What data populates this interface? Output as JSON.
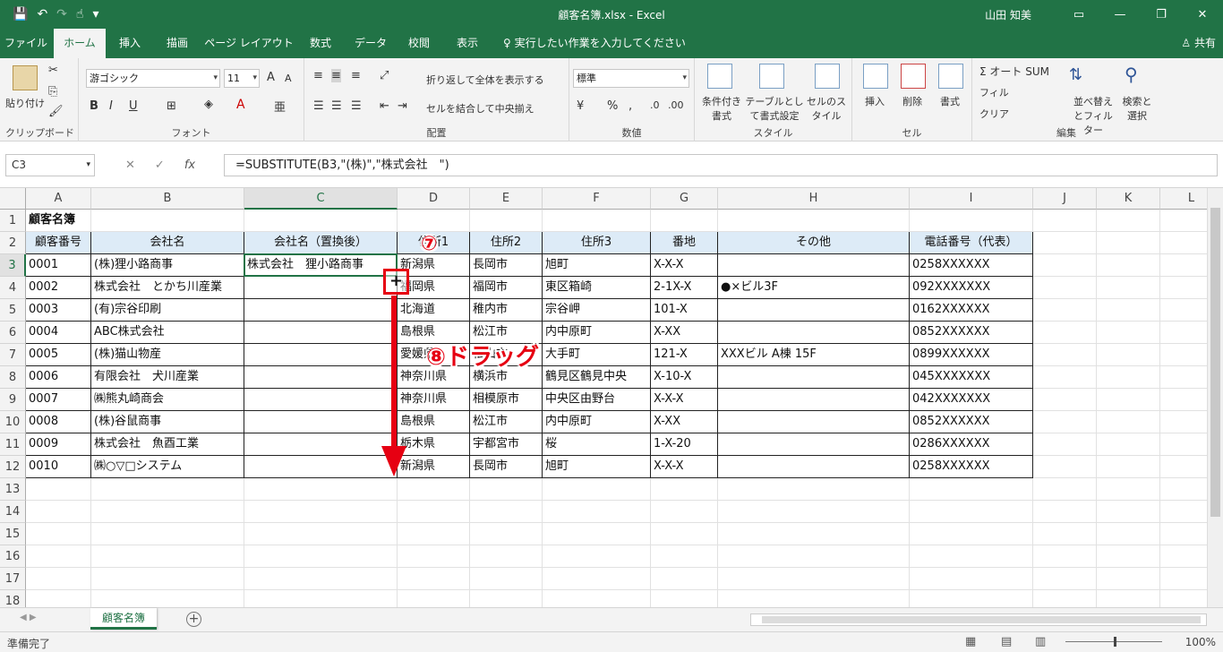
{
  "window": {
    "title": "顧客名簿.xlsx  -  Excel",
    "user": "山田 知美",
    "controls": [
      "▭",
      "—",
      "❐",
      "✕"
    ]
  },
  "qat": {
    "save": "💾",
    "undo": "↶",
    "redo": "↷",
    "touch": "☝",
    "more": "▾"
  },
  "tabs": [
    "ファイル",
    "ホーム",
    "挿入",
    "描画",
    "ページ レイアウト",
    "数式",
    "データ",
    "校閲",
    "表示"
  ],
  "tellme": "♀ 実行したい作業を入力してください",
  "share": "♙ 共有",
  "ribbon": {
    "clipboard": {
      "paste": "貼り付け",
      "label": "クリップボード"
    },
    "font": {
      "name": "游ゴシック",
      "size": "11",
      "bold": "B",
      "italic": "I",
      "underline": "U",
      "grow": "A",
      "shrink": "A",
      "label": "フォント"
    },
    "alignment": {
      "wrap": "折り返して全体を表示する",
      "merge": "セルを結合して中央揃え",
      "label": "配置"
    },
    "number": {
      "format": "標準",
      "percent": "%",
      "comma": ",",
      "label": "数値"
    },
    "styles": {
      "conditional": "条件付き書式",
      "table": "テーブルとして書式設定",
      "cell": "セルのスタイル",
      "label": "スタイル"
    },
    "cells": {
      "insert": "挿入",
      "delete": "削除",
      "format": "書式",
      "label": "セル"
    },
    "editing": {
      "autosum": "Σ オート SUM",
      "fill": "フィル",
      "clear": "クリア",
      "sort": "並べ替えとフィルター",
      "find": "検索と選択",
      "label": "編集"
    }
  },
  "formula_bar": {
    "namebox": "C3",
    "cancel": "✕",
    "enter": "✓",
    "fx": "fx",
    "formula": "=SUBSTITUTE(B3,\"(株)\",\"株式会社　\")"
  },
  "columns": [
    "A",
    "B",
    "C",
    "D",
    "E",
    "F",
    "G",
    "H",
    "I",
    "J",
    "K",
    "L"
  ],
  "rows": [
    "1",
    "2",
    "3",
    "4",
    "5",
    "6",
    "7",
    "8",
    "9",
    "10",
    "11",
    "12",
    "13",
    "14",
    "15",
    "16",
    "17",
    "18"
  ],
  "title_cell": "顧客名簿",
  "headers": [
    "顧客番号",
    "会社名",
    "会社名（置換後）",
    "住所1",
    "住所2",
    "住所3",
    "番地",
    "その他",
    "電話番号（代表）"
  ],
  "table": [
    [
      "0001",
      "(株)狸小路商事",
      "株式会社　狸小路商事",
      "新潟県",
      "長岡市",
      "旭町",
      "X-X-X",
      "",
      "0258XXXXXX"
    ],
    [
      "0002",
      "株式会社　とかち川産業",
      "",
      "福岡県",
      "福岡市",
      "東区箱崎",
      "2-1X-X",
      "●×ビル3F",
      "092XXXXXXX"
    ],
    [
      "0003",
      "(有)宗谷印刷",
      "",
      "北海道",
      "稚内市",
      "宗谷岬",
      "101-X",
      "",
      "0162XXXXXX"
    ],
    [
      "0004",
      "ABC株式会社",
      "",
      "島根県",
      "松江市",
      "内中原町",
      "X-XX",
      "",
      "0852XXXXXX"
    ],
    [
      "0005",
      "(株)猫山物産",
      "",
      "愛媛県",
      "松山市",
      "大手町",
      "121-X",
      "XXXビル A棟 15F",
      "0899XXXXXX"
    ],
    [
      "0006",
      "有限会社　犬川産業",
      "",
      "神奈川県",
      "横浜市",
      "鶴見区鶴見中央",
      "X-10-X",
      "",
      "045XXXXXXX"
    ],
    [
      "0007",
      "㈱熊丸崎商会",
      "",
      "神奈川県",
      "相模原市",
      "中央区由野台",
      "X-X-X",
      "",
      "042XXXXXXX"
    ],
    [
      "0008",
      "(株)谷鼠商事",
      "",
      "島根県",
      "松江市",
      "内中原町",
      "X-XX",
      "",
      "0852XXXXXX"
    ],
    [
      "0009",
      "株式会社　魚酉工業",
      "",
      "栃木県",
      "宇都宮市",
      "桜",
      "1-X-20",
      "",
      "0286XXXXXX"
    ],
    [
      "0010",
      "㈱○▽□システム",
      "",
      "新潟県",
      "長岡市",
      "旭町",
      "X-X-X",
      "",
      "0258XXXXXX"
    ]
  ],
  "annotations": {
    "step7": "⑦",
    "step8": "⑧ドラッグ",
    "handle": "+"
  },
  "sheet_tab": "顧客名簿",
  "add_sheet": "+",
  "status": {
    "ready": "準備完了",
    "zoom": "100%"
  }
}
